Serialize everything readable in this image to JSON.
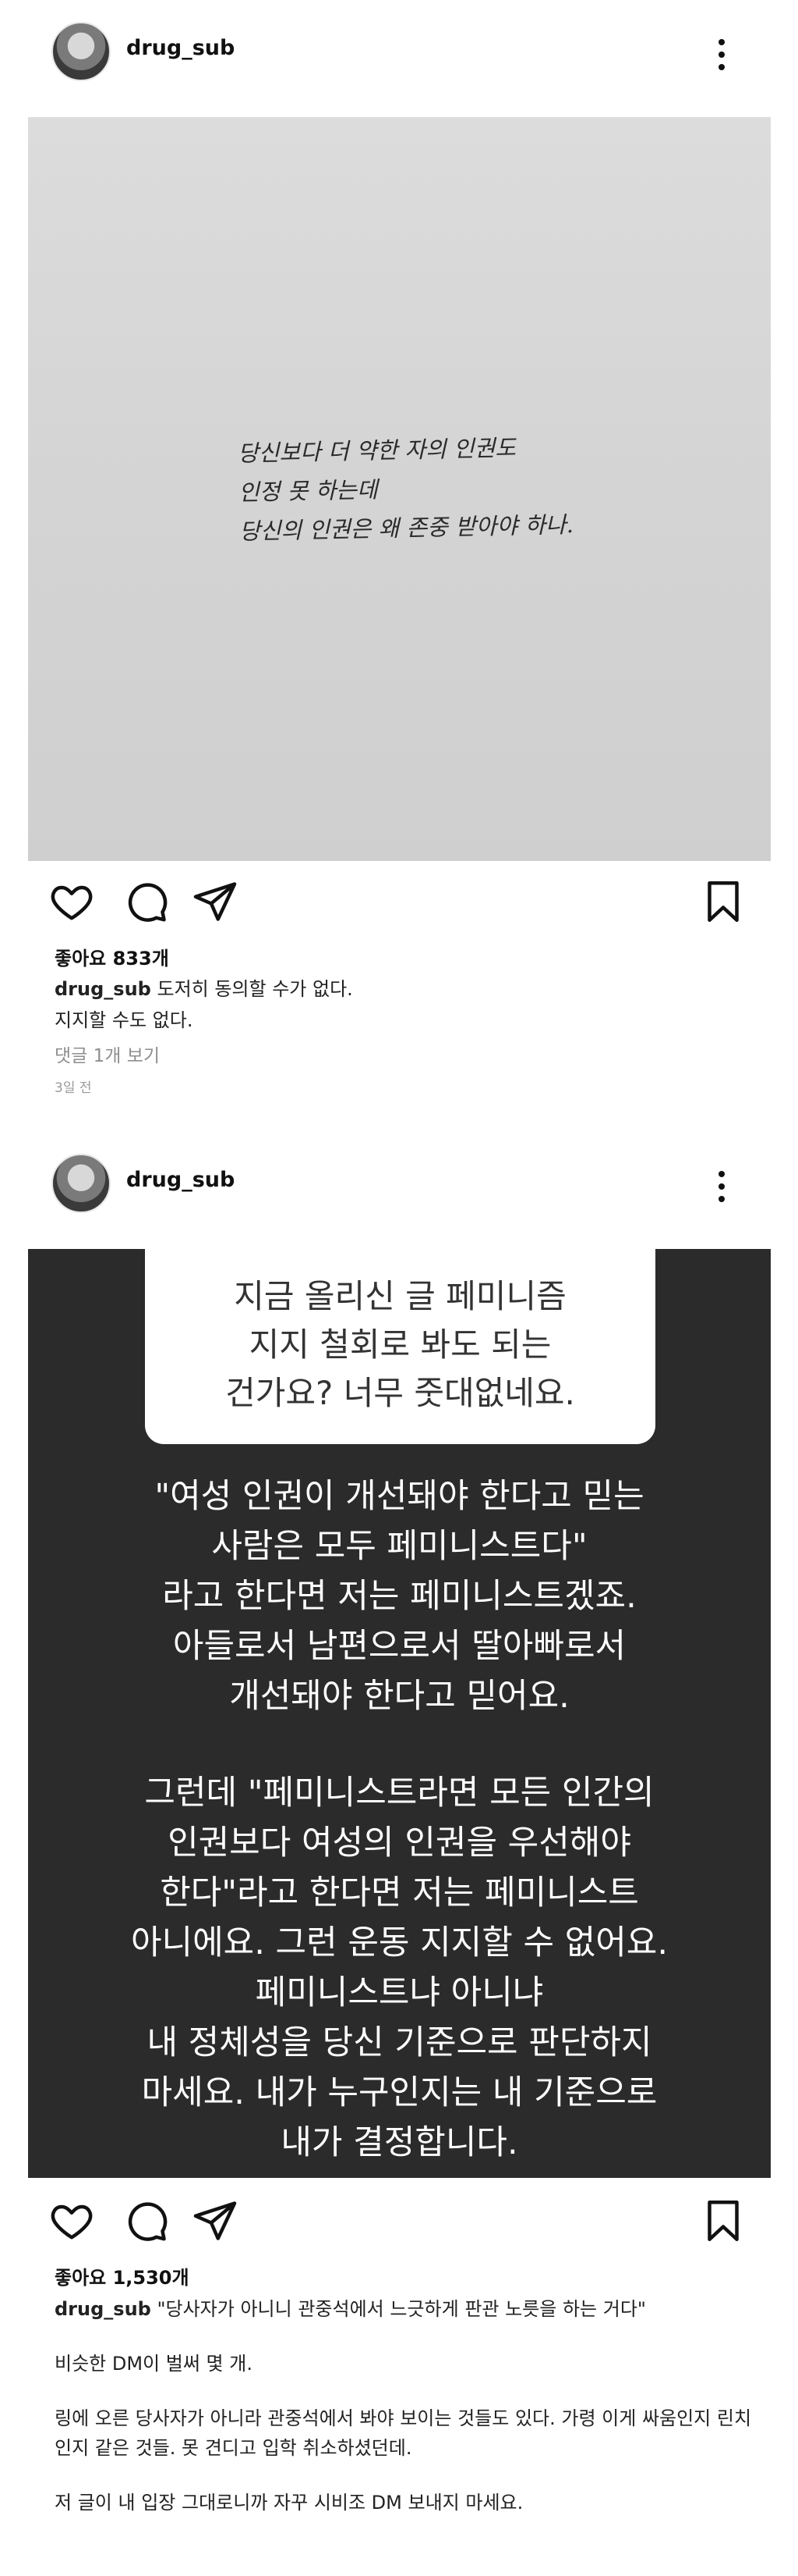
{
  "posts": [
    {
      "username": "drug_sub",
      "image_text": [
        "당신보다 더 약한 자의 인권도",
        "인정 못 하는데",
        "당신의 인권은 왜 존중 받아야 하나."
      ],
      "likes": "좋아요 833개",
      "caption_user": "drug_sub",
      "caption_text": "도저히 동의할 수가 없다.",
      "caption_text_2": "지지할 수도 없다.",
      "comments_link": "댓글 1개 보기",
      "timestamp": "3일 전"
    },
    {
      "username": "drug_sub",
      "question": [
        "지금 올리신 글 페미니즘",
        "지지 철회로 봐도 되는",
        "건가요? 너무 줏대없네요."
      ],
      "answer_block_1": [
        "\"여성 인권이 개선돼야 한다고 믿는",
        "사람은 모두 페미니스트다\"",
        "라고 한다면 저는 페미니스트겠죠.",
        "아들로서 남편으로서 딸아빠로서",
        "개선돼야 한다고 믿어요."
      ],
      "answer_block_2": [
        "그런데 \"페미니스트라면 모든 인간의",
        "인권보다 여성의 인권을 우선해야",
        "한다\"라고 한다면 저는 페미니스트",
        "아니에요. 그런 운동 지지할 수 없어요.",
        "페미니스트냐 아니냐",
        "내 정체성을 당신 기준으로 판단하지",
        "마세요. 내가 누구인지는 내 기준으로",
        "내가 결정합니다."
      ],
      "likes": "좋아요 1,530개",
      "caption_user": "drug_sub",
      "caption_text": "\"당사자가 아니니 관중석에서 느긋하게 판관 노릇을 하는 거다\"",
      "paragraphs": [
        "비슷한 DM이 벌써 몇 개.",
        "링에 오른 당사자가 아니라 관중석에서 봐야 보이는 것들도 있다. 가령 이게 싸움인지 린치인지 같은 것들. 못 견디고 입학 취소하셨던데.",
        "저 글이 내 입장 그대로니까 자꾸 시비조 DM 보내지 마세요."
      ]
    }
  ],
  "icons": {
    "more": "more-options-icon",
    "like": "heart-icon",
    "comment": "comment-icon",
    "share": "share-icon",
    "save": "bookmark-icon"
  }
}
